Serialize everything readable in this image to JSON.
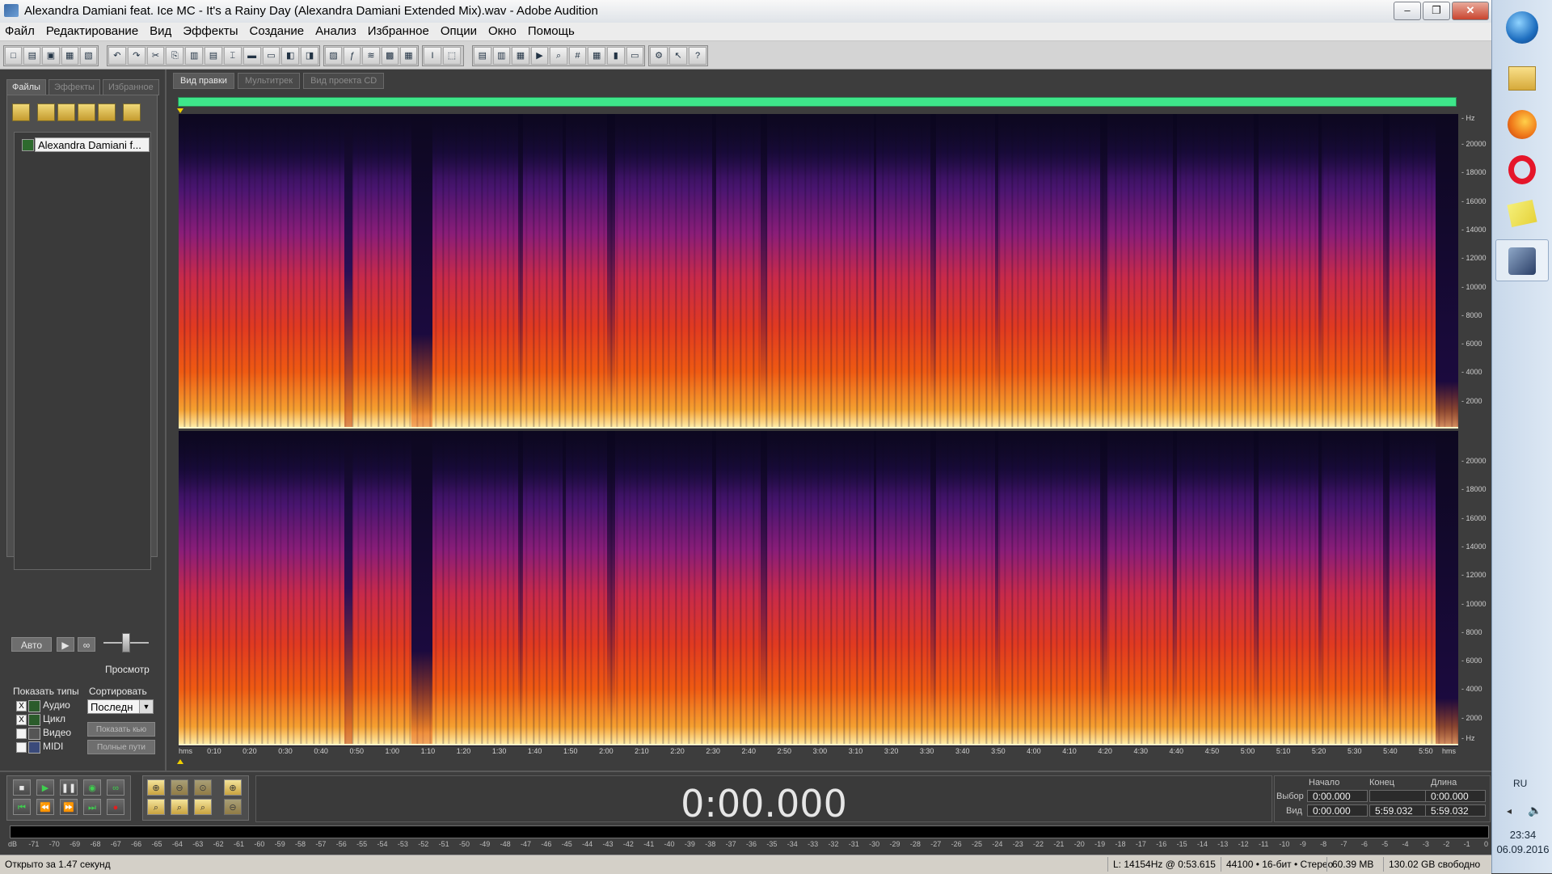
{
  "window": {
    "title": "Alexandra Damiani feat. Ice MC - It's a Rainy Day (Alexandra Damiani Extended Mix).wav - Adobe Audition",
    "minimize": "‒",
    "restore": "❐",
    "close": "✕"
  },
  "menu": [
    "Файл",
    "Редактирование",
    "Вид",
    "Эффекты",
    "Создание",
    "Анализ",
    "Избранное",
    "Опции",
    "Окно",
    "Помощь"
  ],
  "side": {
    "tabs": [
      "Файлы",
      "Эффекты",
      "Избранное"
    ],
    "file_item": "Alexandra Damiani f...",
    "auto_btn": "Авто",
    "play_btn": "▶",
    "loop_btn": "∞",
    "preview_label": "Просмотр",
    "show_types_label": "Показать типы",
    "sort_label": "Сортировать",
    "sort_value": "Последн",
    "types": [
      "Аудио",
      "Цикл",
      "Видео",
      "MIDI"
    ],
    "type_checked": [
      "X",
      "X",
      "",
      ""
    ],
    "btn_show": "Показать кью",
    "btn_full_paths": "Полные пути"
  },
  "content": {
    "tabs": [
      "Вид правки",
      "Мультитрек",
      "Вид проекта CD"
    ]
  },
  "freq_axis": {
    "unit": "Hz",
    "labels": [
      "20000",
      "18000",
      "16000",
      "14000",
      "12000",
      "10000",
      "8000",
      "6000",
      "4000",
      "2000"
    ]
  },
  "time_axis": {
    "unit": "hms",
    "labels": [
      "0:10",
      "0:20",
      "0:30",
      "0:40",
      "0:50",
      "1:00",
      "1:10",
      "1:20",
      "1:30",
      "1:40",
      "1:50",
      "2:00",
      "2:10",
      "2:20",
      "2:30",
      "2:40",
      "2:50",
      "3:00",
      "3:10",
      "3:20",
      "3:30",
      "3:40",
      "3:50",
      "4:00",
      "4:10",
      "4:20",
      "4:30",
      "4:40",
      "4:50",
      "5:00",
      "5:10",
      "5:20",
      "5:30",
      "5:40",
      "5:50"
    ],
    "end_unit": "hms"
  },
  "transport": {
    "time": "0:00.000",
    "sel_headers": [
      "Начало",
      "Конец",
      "Длина"
    ],
    "row_labels": [
      "Выбор",
      "Вид"
    ],
    "row1": [
      "0:00.000",
      "",
      "0:00.000"
    ],
    "row2": [
      "0:00.000",
      "5:59.032",
      "5:59.032"
    ]
  },
  "meter": {
    "labels": [
      "dB",
      "-71",
      "-70",
      "-69",
      "-68",
      "-67",
      "-66",
      "-65",
      "-64",
      "-63",
      "-62",
      "-61",
      "-60",
      "-59",
      "-58",
      "-57",
      "-56",
      "-55",
      "-54",
      "-53",
      "-52",
      "-51",
      "-50",
      "-49",
      "-48",
      "-47",
      "-46",
      "-45",
      "-44",
      "-43",
      "-42",
      "-41",
      "-40",
      "-39",
      "-38",
      "-37",
      "-36",
      "-35",
      "-34",
      "-33",
      "-32",
      "-31",
      "-30",
      "-29",
      "-28",
      "-27",
      "-26",
      "-25",
      "-24",
      "-23",
      "-22",
      "-21",
      "-20",
      "-19",
      "-18",
      "-17",
      "-16",
      "-15",
      "-14",
      "-13",
      "-12",
      "-11",
      "-10",
      "-9",
      "-8",
      "-7",
      "-6",
      "-5",
      "-4",
      "-3",
      "-2",
      "-1",
      "0"
    ]
  },
  "status": {
    "left": "Открыто за 1.47 секунд",
    "cursor": "L: 14154Hz @   0:53.615",
    "format": "44100 • 16-бит • Стерео",
    "size": "60.39 MB",
    "free": "130.02 GB свободно"
  },
  "taskbar": {
    "lang": "RU",
    "time": "23:34",
    "date": "06.09.2016"
  }
}
